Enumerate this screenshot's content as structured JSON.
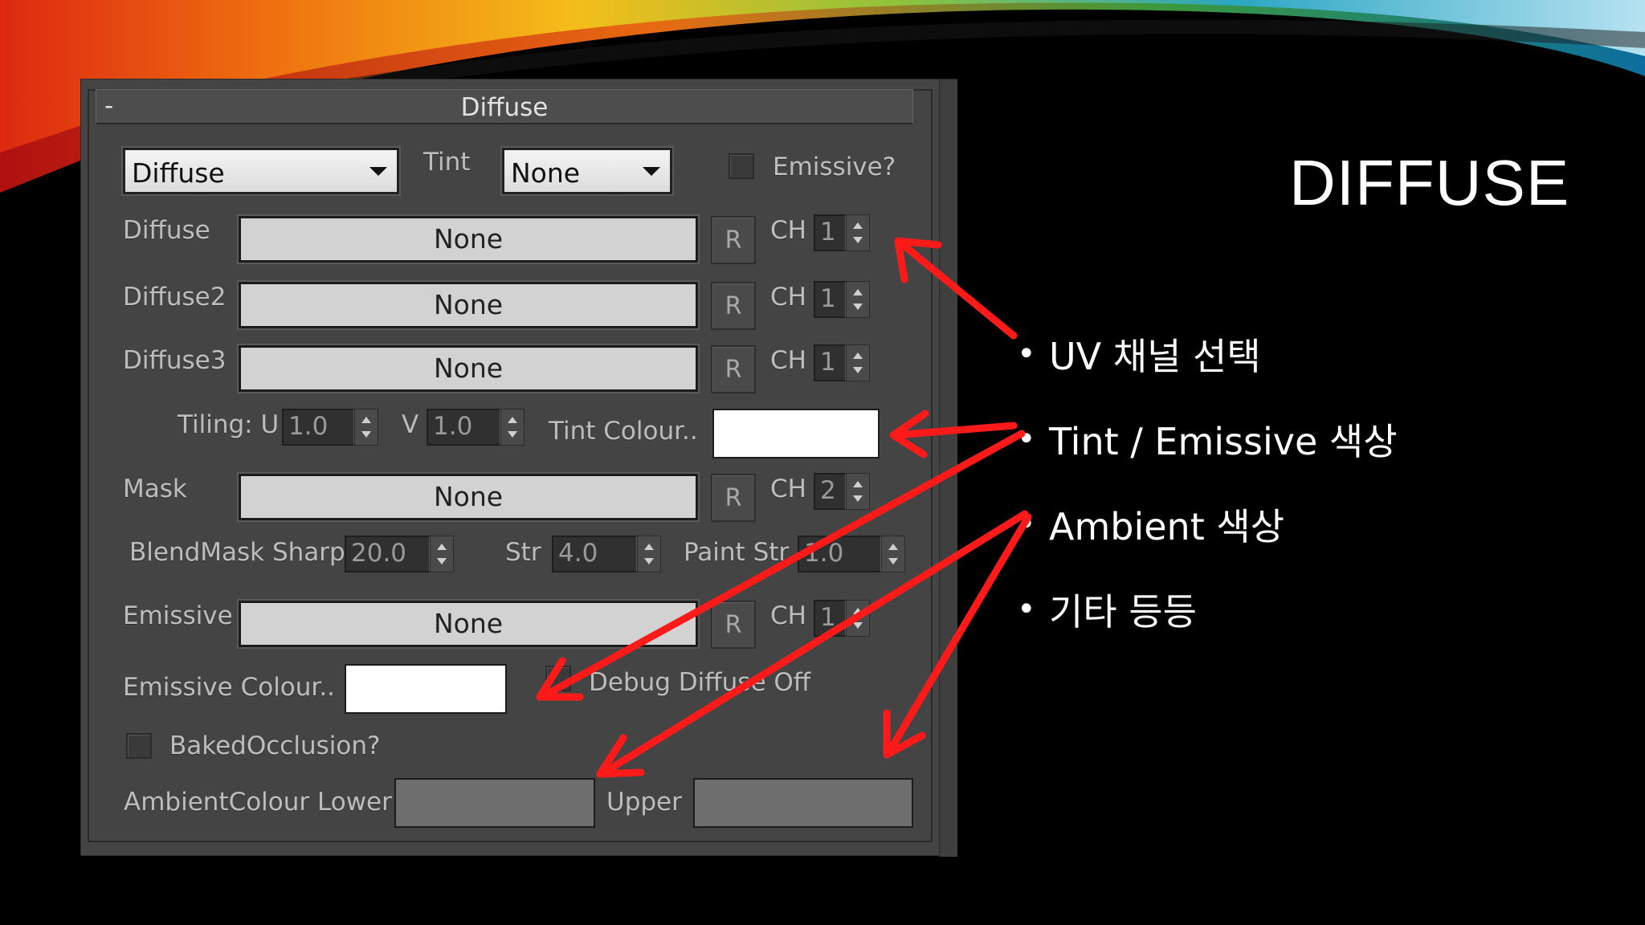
{
  "slide": {
    "title": "DIFFUSE",
    "bullets": [
      "UV 채널 선택",
      "Tint / Emissive 색상",
      "Ambient 색상",
      "기타 등등"
    ]
  },
  "panel": {
    "header_minus": "-",
    "header_title": "Diffuse",
    "mode_select": "Diffuse",
    "tint_label": "Tint",
    "tint_select": "None",
    "emissive_check_label": "Emissive?",
    "rows": [
      {
        "label": "Diffuse",
        "map": "None",
        "r": "R",
        "ch_label": "CH",
        "ch": "1"
      },
      {
        "label": "Diffuse2",
        "map": "None",
        "r": "R",
        "ch_label": "CH",
        "ch": "1"
      },
      {
        "label": "Diffuse3",
        "map": "None",
        "r": "R",
        "ch_label": "CH",
        "ch": "1"
      }
    ],
    "tiling_label": "Tiling: U",
    "tiling_u": "1.0",
    "tiling_v_label": "V",
    "tiling_v": "1.0",
    "tint_colour_label": "Tint Colour..",
    "tint_colour": "#ffffff",
    "mask": {
      "label": "Mask",
      "map": "None",
      "r": "R",
      "ch_label": "CH",
      "ch": "2"
    },
    "blendmask_label": "BlendMask Sharp",
    "blendmask_value": "20.0",
    "str_label": "Str",
    "str_value": "4.0",
    "paint_str_label": "Paint Str",
    "paint_str_value": "1.0",
    "emissive": {
      "label": "Emissive",
      "map": "None",
      "r": "R",
      "ch_label": "CH",
      "ch": "1"
    },
    "emissive_colour_label": "Emissive Colour..",
    "emissive_colour": "#ffffff",
    "debug_label": "Debug Diffuse Off",
    "baked_occlusion_label": "BakedOcclusion?",
    "ambient_lower_label": "AmbientColour Lower",
    "ambient_lower": "#6e6e6e",
    "ambient_upper_label": "Upper",
    "ambient_upper": "#6e6e6e"
  },
  "colors": {
    "panel_bg": "#444444",
    "annotation_arrow": "#ff1a1a"
  }
}
